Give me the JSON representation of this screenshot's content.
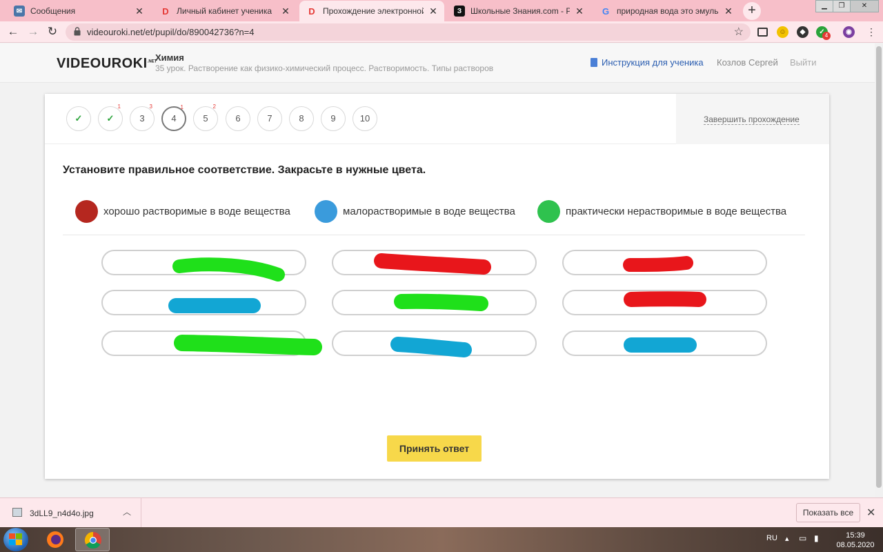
{
  "browser": {
    "tabs": [
      {
        "title": "Сообщения",
        "icon": "vk-icon",
        "color": "#4a76a8",
        "active": false
      },
      {
        "title": "Личный кабинет ученика",
        "icon": "videouroki-icon",
        "color": "#e53935",
        "active": false
      },
      {
        "title": "Прохождение электронной тет",
        "icon": "videouroki-icon",
        "color": "#e53935",
        "active": true
      },
      {
        "title": "Школьные Знания.com - Решае",
        "icon": "znanija-icon",
        "color": "#111111",
        "active": false
      },
      {
        "title": "природная вода это эмульсия -",
        "icon": "google-icon",
        "color": "#4285f4",
        "active": false
      }
    ],
    "tab_close": "✕",
    "new_tab": "+",
    "url": "videouroki.net/et/pupil/do/890042736?n=4",
    "extension_badge": "4"
  },
  "header": {
    "logo_main": "VIDEOUROKI",
    "logo_suffix": ".NET",
    "subject": "Химия",
    "lesson": "35 урок. Растворение как физико-химический процесс. Растворимость. Типы растворов",
    "instructions": "Инструкция для ученика",
    "user_name": "Козлов Сергей",
    "logout": "Выйти"
  },
  "steps": [
    {
      "label": "",
      "state": "done",
      "badge": ""
    },
    {
      "label": "",
      "state": "done",
      "badge": "1"
    },
    {
      "label": "3",
      "state": "open",
      "badge": "3"
    },
    {
      "label": "4",
      "state": "current",
      "badge": "1"
    },
    {
      "label": "5",
      "state": "open",
      "badge": "2"
    },
    {
      "label": "6",
      "state": "open",
      "badge": ""
    },
    {
      "label": "7",
      "state": "open",
      "badge": ""
    },
    {
      "label": "8",
      "state": "open",
      "badge": ""
    },
    {
      "label": "9",
      "state": "open",
      "badge": ""
    },
    {
      "label": "10",
      "state": "open",
      "badge": ""
    }
  ],
  "finish_label": "Завершить прохождение",
  "task": {
    "prompt": "Установите правильное соответствие. Закрасьте в нужные цвета.",
    "legend": [
      {
        "label": "хорошо растворимые в воде вещества",
        "color": "#b5271f"
      },
      {
        "label": "малорастворимые в воде вещества",
        "color": "#3a9bdc"
      },
      {
        "label": "практически нерастворимые в воде вещества",
        "color": "#2fc24e"
      }
    ],
    "cells": [
      {
        "paint": "#1fe01a"
      },
      {
        "paint": "#e8161b"
      },
      {
        "paint": "#e8161b"
      },
      {
        "paint": "#12a6d4"
      },
      {
        "paint": "#1fe01a"
      },
      {
        "paint": "#e8161b"
      },
      {
        "paint": "#1fe01a"
      },
      {
        "paint": "#12a6d4"
      },
      {
        "paint": "#12a6d4"
      }
    ],
    "submit": "Принять ответ"
  },
  "downloads": {
    "file": "3dLL9_n4d4o.jpg",
    "show_all": "Показать все"
  },
  "taskbar": {
    "lang": "RU",
    "time": "15:39",
    "date": "08.05.2020"
  }
}
